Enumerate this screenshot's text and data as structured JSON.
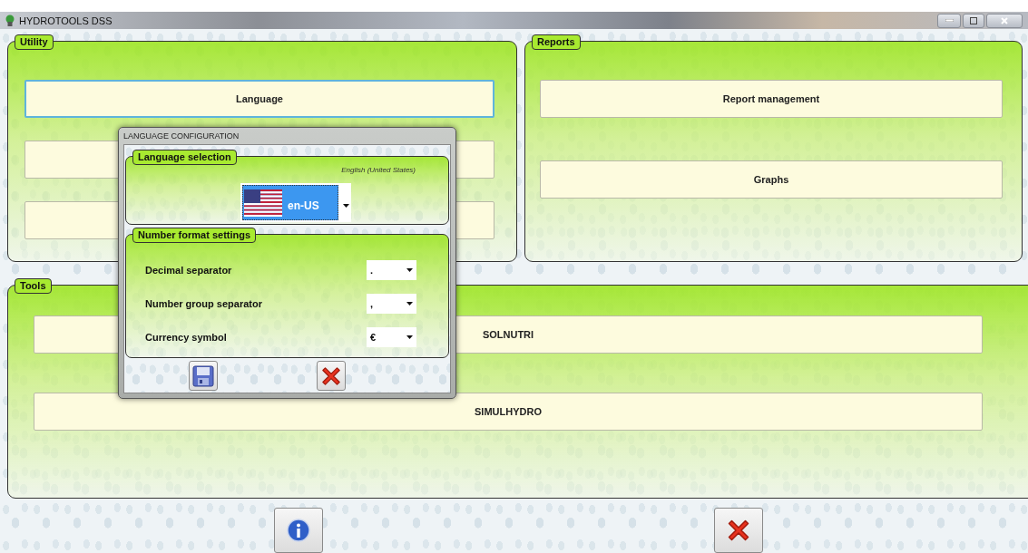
{
  "window": {
    "title": "HYDROTOOLS DSS"
  },
  "utility": {
    "title": "Utility",
    "buttons": [
      {
        "kind": "button",
        "label": "Language",
        "focused": true
      },
      {
        "kind": "covered",
        "focused": false
      },
      {
        "kind": "covered",
        "focused": false
      }
    ]
  },
  "reports": {
    "title": "Reports",
    "buttons": [
      {
        "label": "Report management",
        "focused": false
      },
      {
        "label": "Graphs",
        "focused": false
      }
    ]
  },
  "tools": {
    "title": "Tools",
    "buttons": [
      {
        "label": "SOLNUTRI",
        "focused": false
      },
      {
        "label": "SIMULHYDRO",
        "focused": false
      }
    ]
  },
  "dialog": {
    "title": "LANGUAGE CONFIGURATION",
    "language_group": {
      "title": "Language selection",
      "language_name": "English (United States)",
      "selected_culture": "en-US"
    },
    "number_group": {
      "title": "Number format settings",
      "rows": [
        {
          "label": "Decimal separator",
          "value": "."
        },
        {
          "label": "Number group separator",
          "value": ","
        },
        {
          "label": "Currency symbol",
          "value": "€"
        }
      ]
    }
  }
}
